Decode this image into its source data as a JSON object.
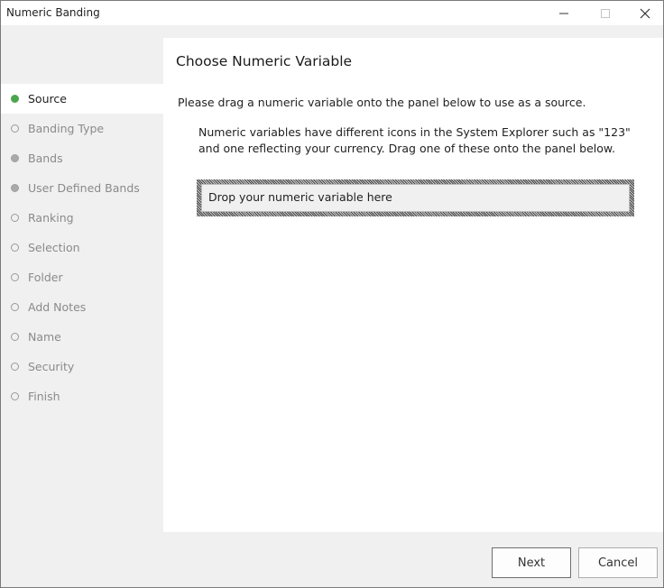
{
  "window": {
    "title": "Numeric Banding",
    "controls": {
      "minimize": "minimize-icon",
      "maximize": "maximize-icon",
      "close": "close-icon"
    }
  },
  "steps": [
    {
      "label": "Source",
      "state": "current"
    },
    {
      "label": "Banding Type",
      "state": "pending"
    },
    {
      "label": "Bands",
      "state": "filled"
    },
    {
      "label": "User Defined Bands",
      "state": "filled"
    },
    {
      "label": "Ranking",
      "state": "pending"
    },
    {
      "label": "Selection",
      "state": "pending"
    },
    {
      "label": "Folder",
      "state": "pending"
    },
    {
      "label": "Add Notes",
      "state": "pending"
    },
    {
      "label": "Name",
      "state": "pending"
    },
    {
      "label": "Security",
      "state": "pending"
    },
    {
      "label": "Finish",
      "state": "pending"
    }
  ],
  "main": {
    "heading": "Choose Numeric Variable",
    "instruction": "Please drag a numeric variable onto the panel below to use as a source.",
    "hint_line1": "Numeric variables have different icons in the System Explorer such as \"123\"",
    "hint_line2": "and one reflecting your currency. Drag one of these onto the panel below.",
    "dropzone_text": "Drop your numeric variable here"
  },
  "buttons": {
    "next": "Next",
    "cancel": "Cancel"
  },
  "colors": {
    "current_step_dot": "#4ca64c",
    "pending_step_text": "#8a8a8a"
  }
}
